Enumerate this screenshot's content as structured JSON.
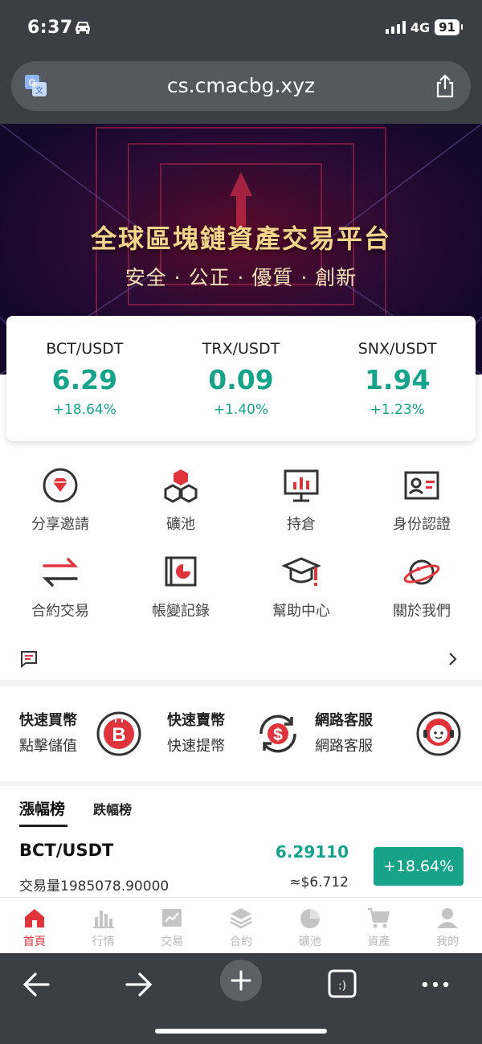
{
  "status_bar": {
    "time": "6:37",
    "network": "4G",
    "battery": "91"
  },
  "browser": {
    "url": "cs.cmacbg.xyz"
  },
  "banner": {
    "title": "全球區塊鏈資產交易平台",
    "subtitle": "安全 · 公正 · 優質 · 創新"
  },
  "tickers": [
    {
      "pair": "BCT/USDT",
      "price": "6.29",
      "change": "+18.64%"
    },
    {
      "pair": "TRX/USDT",
      "price": "0.09",
      "change": "+1.40%"
    },
    {
      "pair": "SNX/USDT",
      "price": "1.94",
      "change": "+1.23%"
    }
  ],
  "grid": [
    {
      "label": "分享邀請",
      "icon": "diamond-icon"
    },
    {
      "label": "礦池",
      "icon": "cubes-icon"
    },
    {
      "label": "持倉",
      "icon": "presentation-chart-icon"
    },
    {
      "label": "身份認證",
      "icon": "id-card-icon"
    },
    {
      "label": "合約交易",
      "icon": "swap-arrows-icon"
    },
    {
      "label": "帳變記錄",
      "icon": "pie-book-icon"
    },
    {
      "label": "幫助中心",
      "icon": "graduation-cap-icon"
    },
    {
      "label": "關於我們",
      "icon": "planet-icon"
    }
  ],
  "quick": [
    {
      "title": "快速買幣",
      "sub": "點擊儲值",
      "icon": "bitcoin-coin-icon"
    },
    {
      "title": "快速賣幣",
      "sub": "快速提幣",
      "icon": "dollar-exchange-icon"
    },
    {
      "title": "網路客服",
      "sub": "網路客服",
      "icon": "support-agent-icon"
    }
  ],
  "rank_tabs": {
    "active": "漲幅榜",
    "other": "跌幅榜"
  },
  "rank_rows": [
    {
      "pair": "BCT/USDT",
      "volume": "交易量1985078.90000",
      "price": "6.29110",
      "usd": "≈$6.712",
      "change": "+18.64%"
    }
  ],
  "tabbar": [
    {
      "label": "首頁",
      "icon": "home-icon",
      "active": true
    },
    {
      "label": "行情",
      "icon": "bar-chart-icon",
      "active": false
    },
    {
      "label": "交易",
      "icon": "trend-chart-icon",
      "active": false
    },
    {
      "label": "合約",
      "icon": "layers-icon",
      "active": false
    },
    {
      "label": "礦池",
      "icon": "pie-icon",
      "active": false
    },
    {
      "label": "資產",
      "icon": "cart-icon",
      "active": false
    },
    {
      "label": "我的",
      "icon": "user-icon",
      "active": false
    }
  ],
  "colors": {
    "accent_green": "#16a38a",
    "accent_red": "#e0343c",
    "chrome": "#3b3e42"
  }
}
